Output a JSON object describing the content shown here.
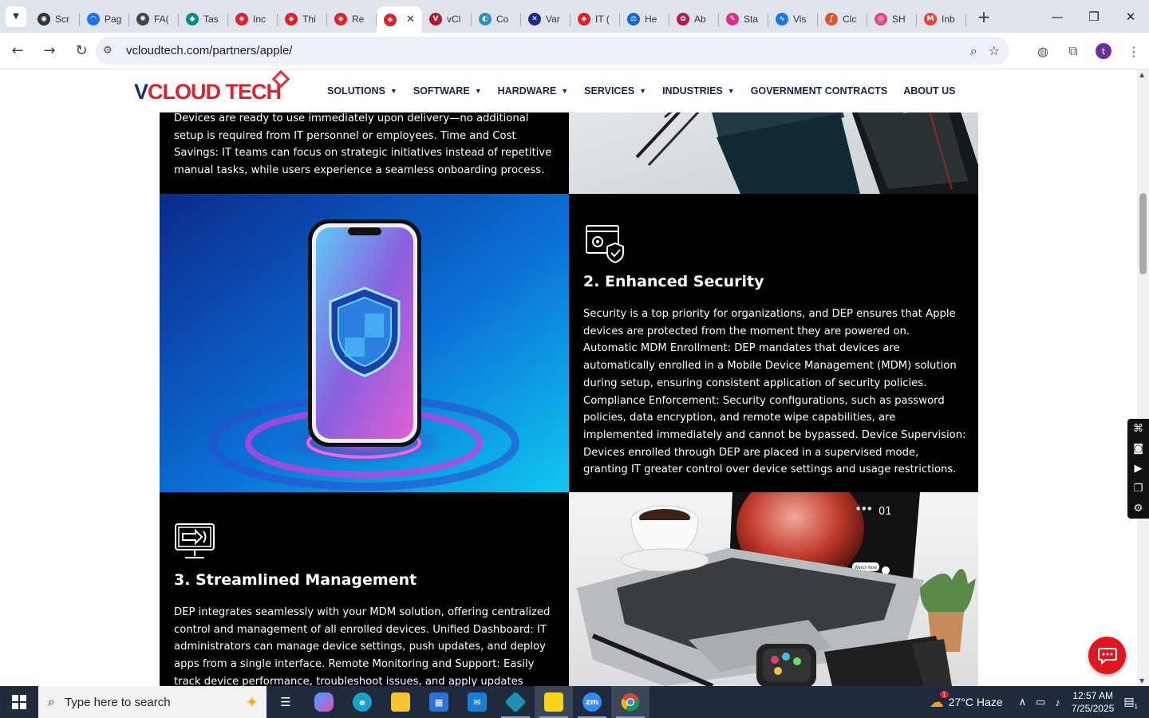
{
  "browser": {
    "tabs": [
      {
        "label": "Scr",
        "fav_color": "#333",
        "fav_glyph": "◉"
      },
      {
        "label": "Pag",
        "fav_color": "#1a73e8",
        "fav_glyph": "◠"
      },
      {
        "label": "FA(",
        "fav_color": "#444",
        "fav_glyph": "✺"
      },
      {
        "label": "Tas",
        "fav_color": "#0f8a8a",
        "fav_glyph": "◆"
      },
      {
        "label": "Inc",
        "fav_color": "#d9242b",
        "fav_glyph": "◈"
      },
      {
        "label": "Thi",
        "fav_color": "#d9242b",
        "fav_glyph": "◈"
      },
      {
        "label": "Re",
        "fav_color": "#d9242b",
        "fav_glyph": "◈"
      },
      {
        "label": "vCl",
        "fav_color": "#b0182b",
        "fav_glyph": "V"
      },
      {
        "label": "Co",
        "fav_color": "#2b8fb8",
        "fav_glyph": "◐"
      },
      {
        "label": "Var",
        "fav_color": "#1c2a8c",
        "fav_glyph": "✕"
      },
      {
        "label": "IT (",
        "fav_color": "#d9242b",
        "fav_glyph": "◈"
      },
      {
        "label": "He",
        "fav_color": "#1668c4",
        "fav_glyph": "⚖"
      },
      {
        "label": "Ab",
        "fav_color": "#b01c4c",
        "fav_glyph": "✿"
      },
      {
        "label": "Sta",
        "fav_color": "#d62f8e",
        "fav_glyph": "✎"
      },
      {
        "label": "Vis",
        "fav_color": "#1a73e8",
        "fav_glyph": "∿"
      },
      {
        "label": "Clc",
        "fav_color": "#e0542b",
        "fav_glyph": "∫"
      },
      {
        "label": "SH",
        "fav_color": "#e04a8a",
        "fav_glyph": "◎"
      },
      {
        "label": "Inb",
        "fav_color": "#ea4335",
        "fav_glyph": "M"
      }
    ],
    "active_tab_close": "✕",
    "url": "vcloudtech.com/partners/apple/",
    "avatar_letter": "t"
  },
  "site": {
    "logo": {
      "part1": "V",
      "part2": "CLOUD TECH"
    },
    "nav": [
      {
        "label": "SOLUTIONS",
        "caret": "▼"
      },
      {
        "label": "SOFTWARE",
        "caret": "▼"
      },
      {
        "label": "HARDWARE",
        "caret": "▼"
      },
      {
        "label": "SERVICES",
        "caret": "▼"
      },
      {
        "label": "INDUSTRIES",
        "caret": "▼"
      },
      {
        "label": "GOVERNMENT CONTRACTS",
        "caret": ""
      },
      {
        "label": "ABOUT US",
        "caret": ""
      }
    ]
  },
  "sections": {
    "top_text": "Devices are ready to use immediately upon delivery—no additional setup is required from IT personnel or employees. Time and Cost Savings: IT teams can focus on strategic initiatives instead of repetitive manual tasks, while users experience a seamless onboarding process.",
    "security": {
      "title": "2. Enhanced Security",
      "body": "Security is a top priority for organizations, and DEP ensures that Apple devices are protected from the moment they are powered on. Automatic MDM Enrollment: DEP mandates that devices are automatically enrolled in a Mobile Device Management (MDM) solution during setup, ensuring consistent application of security policies. Compliance Enforcement: Security configurations, such as password policies, data encryption, and remote wipe capabilities, are implemented immediately and cannot be bypassed. Device Supervision: Devices enrolled through DEP are placed in a supervised mode, granting IT greater control over device settings and usage restrictions."
    },
    "management": {
      "title": "3. Streamlined Management",
      "body": "DEP integrates seamlessly with your MDM solution, offering centralized control and management of all enrolled devices. Unified Dashboard: IT administrators can manage device settings, push updates, and deploy apps from a single interface. Remote Monitoring and Support: Easily track device performance, troubleshoot issues, and apply updates"
    },
    "watch_text": {
      "line1": "01",
      "pill": "Watch Now"
    }
  },
  "taskbar": {
    "search_placeholder": "Type here to search",
    "weather": "27°C  Haze",
    "weather_badge": "1",
    "time": "12:57 AM",
    "date": "7/25/2025",
    "notif_count": "1"
  },
  "colors": {
    "accent_red": "#d9242b",
    "nav_text": "#1a2350",
    "page_black": "#000000"
  }
}
